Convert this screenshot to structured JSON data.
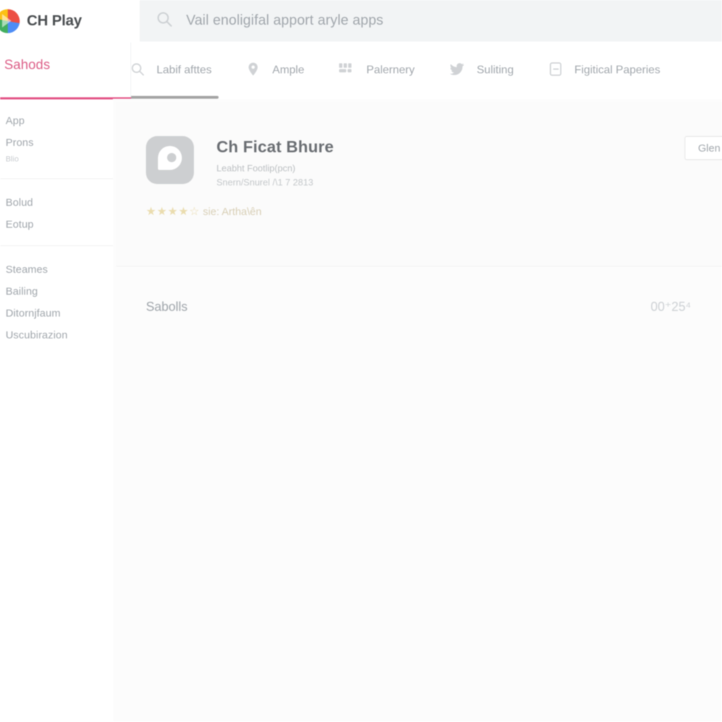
{
  "brand": {
    "name": "CH Play",
    "logo_icon": "play-store-logo-icon"
  },
  "search": {
    "icon": "search-icon",
    "placeholder": "Vail enoligifal apport aryle apps",
    "value": ""
  },
  "nav": {
    "tabs": [
      {
        "label": "Labif afttes",
        "icon": "search-icon",
        "active": true
      },
      {
        "label": "Ample",
        "icon": "location-pin-icon",
        "active": false
      },
      {
        "label": "Palernery",
        "icon": "people-group-icon",
        "active": false
      },
      {
        "label": "Suliting",
        "icon": "twitter-bird-icon",
        "active": false
      },
      {
        "label": "Figitical Paperies",
        "icon": "document-icon",
        "active": false
      }
    ]
  },
  "sidebar": {
    "active_tab": "Sahods",
    "groups": [
      {
        "items": [
          {
            "label": "App",
            "small": false
          },
          {
            "label": "Prons",
            "small": false
          },
          {
            "label": "Blio",
            "small": true
          }
        ]
      },
      {
        "items": [
          {
            "label": "Bolud",
            "small": false
          },
          {
            "label": "Eotup",
            "small": false
          }
        ]
      },
      {
        "items": [
          {
            "label": "Steames",
            "small": false
          },
          {
            "label": "Bailing",
            "small": false
          },
          {
            "label": "Ditornjfaum",
            "small": false
          },
          {
            "label": "Uscubirazion",
            "small": false
          }
        ]
      }
    ]
  },
  "app_card": {
    "icon": "app-tile-icon",
    "title": "Ch Ficat Bhure",
    "subtitle": "Leabht Footlip(pcn)",
    "meta": "Snern/Snurel /\\1 7 2813",
    "stars": "★★★★☆",
    "rating_text": "sie: Artha\\ên",
    "install_label": "Glen c"
  },
  "section": {
    "title": "Sabolls",
    "value": "00⁺25⁴"
  },
  "colors": {
    "accent_pink": "#e0457b",
    "search_bg": "#f1f3f4",
    "text_muted": "#9aa0a6"
  }
}
